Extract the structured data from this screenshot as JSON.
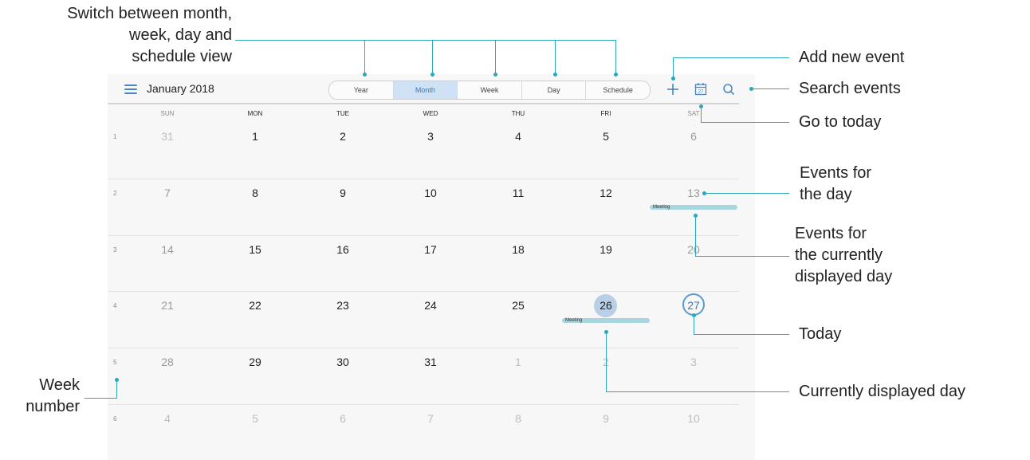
{
  "app": {
    "title": "January 2018",
    "tabs": [
      {
        "label": "Year",
        "active": false
      },
      {
        "label": "Month",
        "active": true
      },
      {
        "label": "Week",
        "active": false
      },
      {
        "label": "Day",
        "active": false
      },
      {
        "label": "Schedule",
        "active": false
      }
    ],
    "toolbar": {
      "add_icon": "plus-icon",
      "today_icon": "calendar-27-icon",
      "today_icon_text": "27",
      "search_icon": "search-icon"
    },
    "weekdays": [
      "SUN",
      "MON",
      "TUE",
      "WED",
      "THU",
      "FRI",
      "SAT"
    ],
    "weeks": [
      {
        "number": "1",
        "days": [
          "31",
          "1",
          "2",
          "3",
          "4",
          "5",
          "6"
        ]
      },
      {
        "number": "2",
        "days": [
          "7",
          "8",
          "9",
          "10",
          "11",
          "12",
          "13"
        ]
      },
      {
        "number": "3",
        "days": [
          "14",
          "15",
          "16",
          "17",
          "18",
          "19",
          "20"
        ]
      },
      {
        "number": "4",
        "days": [
          "21",
          "22",
          "23",
          "24",
          "25",
          "26",
          "27"
        ]
      },
      {
        "number": "5",
        "days": [
          "28",
          "29",
          "30",
          "31",
          "1",
          "2",
          "3"
        ]
      },
      {
        "number": "6",
        "days": [
          "4",
          "5",
          "6",
          "7",
          "8",
          "9",
          "10"
        ]
      }
    ],
    "events": [
      {
        "label": "Meeting",
        "day": "13"
      },
      {
        "label": "Meeting",
        "day": "26"
      }
    ],
    "selected_day": "26",
    "today": "27",
    "colors": {
      "accent": "#4a84c4",
      "tab_active_bg": "#cfe1f5",
      "event": "#a8d6e0",
      "callout_line": "#2aa7b8",
      "selected_day": "#b8cfe6"
    }
  },
  "callouts": {
    "switch_view": [
      "Switch between month,",
      "week, day and",
      "schedule view"
    ],
    "add_event": "Add new event",
    "search_events": "Search events",
    "go_to_today": "Go to today",
    "events_for_day": [
      "Events for",
      "the day"
    ],
    "events_current_day": [
      "Events for",
      "the currently",
      "displayed day"
    ],
    "today": "Today",
    "currently_displayed_day": "Currently displayed day",
    "week_number": [
      "Week",
      "number"
    ]
  }
}
